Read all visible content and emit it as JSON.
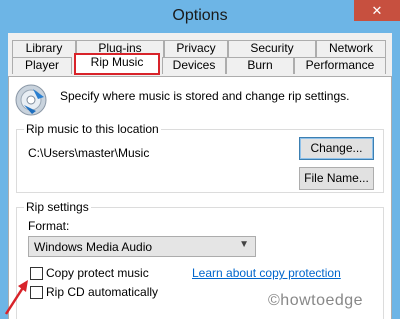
{
  "window": {
    "title": "Options",
    "close_label": "✕"
  },
  "tabs": {
    "row1": [
      "Library",
      "Plug-ins",
      "Privacy",
      "Security",
      "Network"
    ],
    "row2": [
      "Player",
      "Rip Music",
      "Devices",
      "Burn",
      "Performance"
    ],
    "active": "Rip Music"
  },
  "intro_text": "Specify where music is stored and change rip settings.",
  "location_group": {
    "label": "Rip music to this location",
    "path": "C:\\Users\\master\\Music",
    "change_button": "Change...",
    "filename_button": "File Name..."
  },
  "settings_group": {
    "label": "Rip settings",
    "format_label": "Format:",
    "format_value": "Windows Media Audio",
    "copy_protect_label": "Copy protect music",
    "copy_protect_checked": false,
    "learn_link": "Learn about copy protection",
    "rip_auto_label": "Rip CD automatically",
    "rip_auto_checked": false
  },
  "watermark": "©howtoedge",
  "colors": {
    "titlebar": "#6db5e6",
    "close": "#c7503f",
    "highlight": "#d8232a",
    "link": "#0066cc"
  }
}
